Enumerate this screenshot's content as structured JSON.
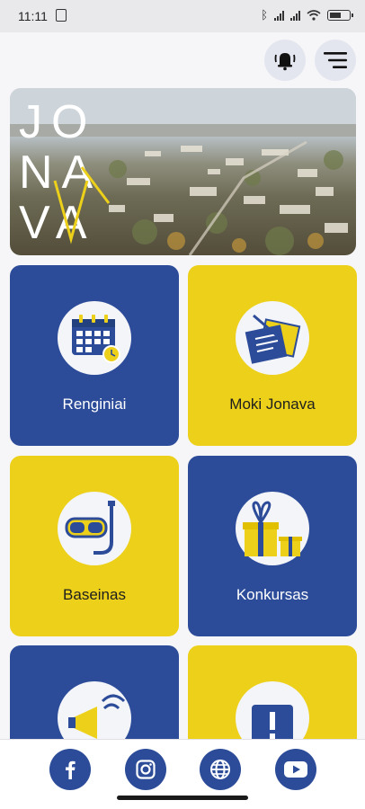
{
  "status_bar": {
    "time": "11:11"
  },
  "header": {
    "notifications_icon": "bell-alert-icon",
    "menu_icon": "hamburger-menu-icon"
  },
  "hero": {
    "logo_text": [
      "JO",
      "NA",
      "VA"
    ]
  },
  "tiles": [
    {
      "label": "Renginiai",
      "color": "#2c4c99",
      "icon": "calendar-icon"
    },
    {
      "label": "Moki Jonava",
      "color": "#ecd01a",
      "icon": "document-icon"
    },
    {
      "label": "Baseinas",
      "color": "#ecd01a",
      "icon": "snorkel-mask-icon"
    },
    {
      "label": "Konkursas",
      "color": "#2c4c99",
      "icon": "gift-icon"
    },
    {
      "label": "",
      "color": "#2c4c99",
      "icon": "megaphone-icon"
    },
    {
      "label": "",
      "color": "#ecd01a",
      "icon": "alert-icon"
    }
  ],
  "social": [
    "facebook-icon",
    "instagram-icon",
    "globe-icon",
    "youtube-icon"
  ],
  "colors": {
    "brand_blue": "#2c4c99",
    "brand_yellow": "#ecd01a"
  }
}
